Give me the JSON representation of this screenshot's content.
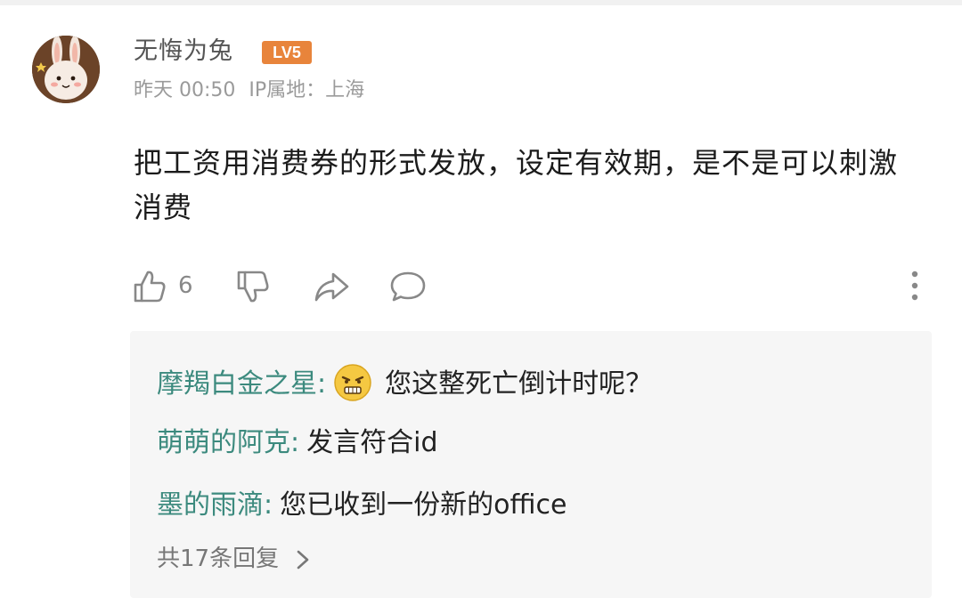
{
  "post": {
    "username": "无悔为兔",
    "level": "LV5",
    "time": "昨天 00:50",
    "ip_label": "IP属地：上海",
    "content": "把工资用消费券的形式发放，设定有效期，是不是可以刺激消费"
  },
  "actions": {
    "like_count": "6"
  },
  "replies": [
    {
      "author": "摩羯白金之星",
      "text": "您这整死亡倒计时呢？",
      "emoji": "grimace-emoji"
    },
    {
      "author": "萌萌的阿克",
      "text": "发言符合id"
    },
    {
      "author": "墨的雨滴",
      "text": "您已收到一份新的office"
    }
  ],
  "reply_sep": ":",
  "more_replies": "共17条回复",
  "colors": {
    "reply_author": "#3c8a7e",
    "level_badge": "#e8843b"
  }
}
